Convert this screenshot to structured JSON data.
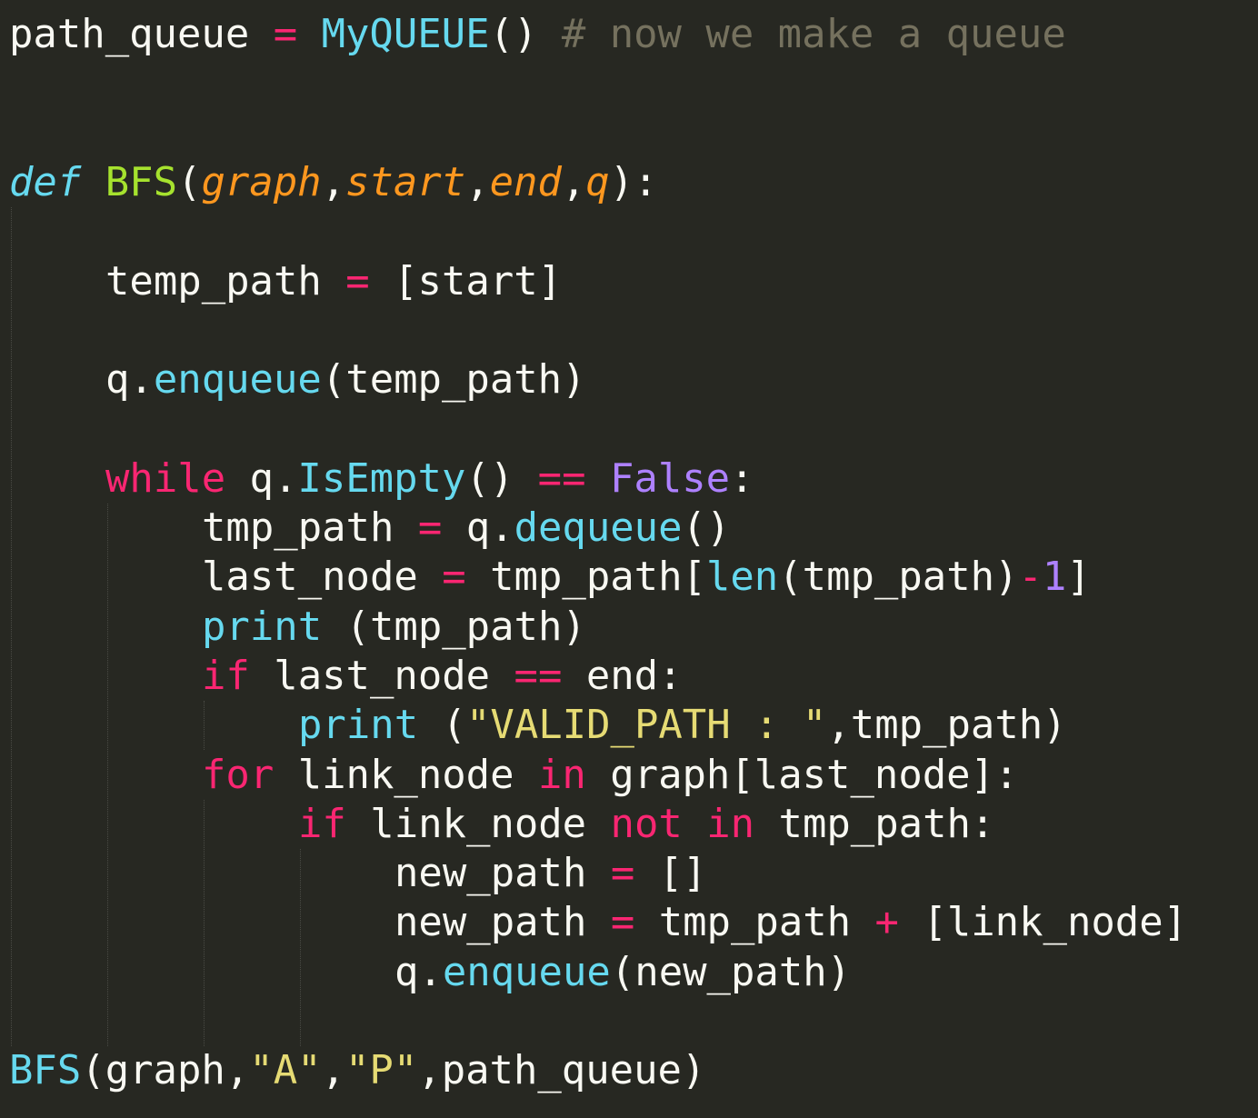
{
  "theme": {
    "background": "#272822",
    "foreground": "#f8f8f2",
    "keyword": "#f92672",
    "function_call": "#66d9ef",
    "function_def": "#a6e22e",
    "parameter": "#fd971f",
    "constant": "#ae81ff",
    "string": "#e6db74",
    "comment": "#75715e"
  },
  "code": {
    "lines": [
      {
        "row": 0,
        "indent": 0,
        "tokens": [
          {
            "t": "path_queue",
            "c": "plain"
          },
          {
            "t": " ",
            "c": "plain"
          },
          {
            "t": "=",
            "c": "op"
          },
          {
            "t": " ",
            "c": "plain"
          },
          {
            "t": "MyQUEUE",
            "c": "call"
          },
          {
            "t": "()",
            "c": "plain"
          },
          {
            "t": " ",
            "c": "plain"
          },
          {
            "t": "# now we make a queue",
            "c": "comment"
          }
        ]
      },
      {
        "row": 3,
        "indent": 0,
        "tokens": [
          {
            "t": "def",
            "c": "def"
          },
          {
            "t": " ",
            "c": "plain"
          },
          {
            "t": "BFS",
            "c": "fn"
          },
          {
            "t": "(",
            "c": "plain"
          },
          {
            "t": "graph",
            "c": "param"
          },
          {
            "t": ",",
            "c": "plain"
          },
          {
            "t": "start",
            "c": "param"
          },
          {
            "t": ",",
            "c": "plain"
          },
          {
            "t": "end",
            "c": "param"
          },
          {
            "t": ",",
            "c": "plain"
          },
          {
            "t": "q",
            "c": "param"
          },
          {
            "t": "):",
            "c": "plain"
          }
        ]
      },
      {
        "row": 5,
        "indent": 1,
        "tokens": [
          {
            "t": "temp_path",
            "c": "plain"
          },
          {
            "t": " ",
            "c": "plain"
          },
          {
            "t": "=",
            "c": "op"
          },
          {
            "t": " [start]",
            "c": "plain"
          }
        ]
      },
      {
        "row": 7,
        "indent": 1,
        "tokens": [
          {
            "t": "q.",
            "c": "plain"
          },
          {
            "t": "enqueue",
            "c": "call"
          },
          {
            "t": "(temp_path)",
            "c": "plain"
          }
        ]
      },
      {
        "row": 9,
        "indent": 1,
        "tokens": [
          {
            "t": "while",
            "c": "kw"
          },
          {
            "t": " q.",
            "c": "plain"
          },
          {
            "t": "IsEmpty",
            "c": "call"
          },
          {
            "t": "() ",
            "c": "plain"
          },
          {
            "t": "==",
            "c": "op"
          },
          {
            "t": " ",
            "c": "plain"
          },
          {
            "t": "False",
            "c": "const"
          },
          {
            "t": ":",
            "c": "plain"
          }
        ]
      },
      {
        "row": 10,
        "indent": 2,
        "tokens": [
          {
            "t": "tmp_path",
            "c": "plain"
          },
          {
            "t": " ",
            "c": "plain"
          },
          {
            "t": "=",
            "c": "op"
          },
          {
            "t": " q.",
            "c": "plain"
          },
          {
            "t": "dequeue",
            "c": "call"
          },
          {
            "t": "()",
            "c": "plain"
          }
        ]
      },
      {
        "row": 11,
        "indent": 2,
        "tokens": [
          {
            "t": "last_node",
            "c": "plain"
          },
          {
            "t": " ",
            "c": "plain"
          },
          {
            "t": "=",
            "c": "op"
          },
          {
            "t": " tmp_path[",
            "c": "plain"
          },
          {
            "t": "len",
            "c": "builtin"
          },
          {
            "t": "(tmp_path)",
            "c": "plain"
          },
          {
            "t": "-",
            "c": "op"
          },
          {
            "t": "1",
            "c": "num"
          },
          {
            "t": "]",
            "c": "plain"
          }
        ]
      },
      {
        "row": 12,
        "indent": 2,
        "tokens": [
          {
            "t": "print",
            "c": "builtin"
          },
          {
            "t": " (tmp_path)",
            "c": "plain"
          }
        ]
      },
      {
        "row": 13,
        "indent": 2,
        "tokens": [
          {
            "t": "if",
            "c": "kw"
          },
          {
            "t": " last_node ",
            "c": "plain"
          },
          {
            "t": "==",
            "c": "op"
          },
          {
            "t": " end:",
            "c": "plain"
          }
        ]
      },
      {
        "row": 14,
        "indent": 3,
        "tokens": [
          {
            "t": "print",
            "c": "builtin"
          },
          {
            "t": " (",
            "c": "plain"
          },
          {
            "t": "\"VALID_PATH : \"",
            "c": "str"
          },
          {
            "t": ",tmp_path)",
            "c": "plain"
          }
        ]
      },
      {
        "row": 15,
        "indent": 2,
        "tokens": [
          {
            "t": "for",
            "c": "kw"
          },
          {
            "t": " link_node ",
            "c": "plain"
          },
          {
            "t": "in",
            "c": "kw"
          },
          {
            "t": " graph[last_node]:",
            "c": "plain"
          }
        ]
      },
      {
        "row": 16,
        "indent": 3,
        "tokens": [
          {
            "t": "if",
            "c": "kw"
          },
          {
            "t": " link_node ",
            "c": "plain"
          },
          {
            "t": "not",
            "c": "kw"
          },
          {
            "t": " ",
            "c": "plain"
          },
          {
            "t": "in",
            "c": "kw"
          },
          {
            "t": " tmp_path:",
            "c": "plain"
          }
        ]
      },
      {
        "row": 17,
        "indent": 4,
        "tokens": [
          {
            "t": "new_path",
            "c": "plain"
          },
          {
            "t": " ",
            "c": "plain"
          },
          {
            "t": "=",
            "c": "op"
          },
          {
            "t": " []",
            "c": "plain"
          }
        ]
      },
      {
        "row": 18,
        "indent": 4,
        "tokens": [
          {
            "t": "new_path",
            "c": "plain"
          },
          {
            "t": " ",
            "c": "plain"
          },
          {
            "t": "=",
            "c": "op"
          },
          {
            "t": " tmp_path ",
            "c": "plain"
          },
          {
            "t": "+",
            "c": "op"
          },
          {
            "t": " [link_node]",
            "c": "plain"
          }
        ]
      },
      {
        "row": 19,
        "indent": 4,
        "tokens": [
          {
            "t": "q.",
            "c": "plain"
          },
          {
            "t": "enqueue",
            "c": "call"
          },
          {
            "t": "(new_path)",
            "c": "plain"
          }
        ]
      },
      {
        "row": 21,
        "indent": 0,
        "tokens": [
          {
            "t": "BFS",
            "c": "call"
          },
          {
            "t": "(graph,",
            "c": "plain"
          },
          {
            "t": "\"A\"",
            "c": "str"
          },
          {
            "t": ",",
            "c": "plain"
          },
          {
            "t": "\"P\"",
            "c": "str"
          },
          {
            "t": ",path_queue)",
            "c": "plain"
          }
        ]
      }
    ],
    "indent_guides": [
      {
        "level": 0,
        "from_row": 4,
        "to_row": 20
      },
      {
        "level": 1,
        "from_row": 10,
        "to_row": 20
      },
      {
        "level": 2,
        "from_row": 14,
        "to_row": 14
      },
      {
        "level": 2,
        "from_row": 16,
        "to_row": 20
      },
      {
        "level": 3,
        "from_row": 17,
        "to_row": 20
      }
    ]
  }
}
